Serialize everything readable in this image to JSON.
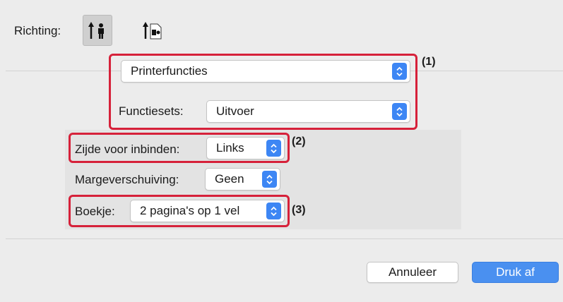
{
  "orientation": {
    "label": "Richting:",
    "options": [
      {
        "icon": "portrait-orientation-icon",
        "selected": true
      },
      {
        "icon": "landscape-orientation-icon",
        "selected": false
      }
    ]
  },
  "panel_select": {
    "value": "Printerfuncties"
  },
  "feature_sets": {
    "label": "Functiesets:",
    "value": "Uitvoer"
  },
  "binding_edge": {
    "label": "Zijde voor inbinden:",
    "value": "Links"
  },
  "margin_shift": {
    "label": "Margeverschuiving:",
    "value": "Geen"
  },
  "booklet": {
    "label": "Boekje:",
    "value": "2 pagina's op 1 vel"
  },
  "callouts": {
    "one": "(1)",
    "two": "(2)",
    "three": "(3)"
  },
  "buttons": {
    "cancel": "Annuleer",
    "print": "Druk af"
  },
  "colors": {
    "accent": "#3d86f4",
    "callout": "#d6213a",
    "primary_button": "#4a90f0"
  }
}
